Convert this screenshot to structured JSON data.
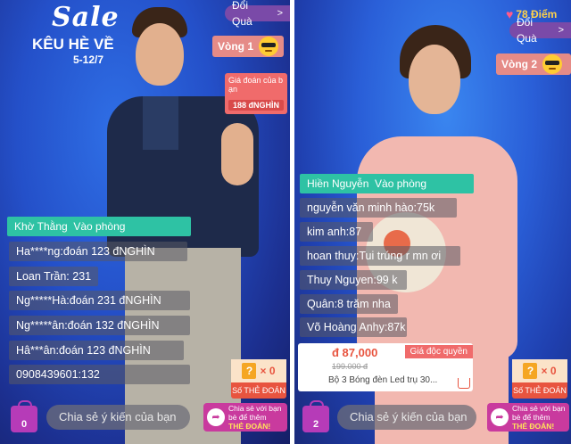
{
  "left": {
    "promo": {
      "title": "Sale",
      "subtitle": "KÊU HÈ VỀ",
      "date": "5-12/7"
    },
    "gift_button": "Đổi Quà",
    "round_label": "Vòng 1",
    "guess_card": {
      "label": "Giá đoán của b ạn",
      "value": "188 đNGHÌN"
    },
    "join_message": {
      "user": "Khờ Thằng",
      "action": "Vào phòng"
    },
    "chat": [
      "Ha****ng:đoán 123 đNGHÌN",
      "Loan Trần: 231",
      "Ng*****Hà:đoán 231 đNGHÌN",
      "Ng*****ân:đoán 132 đNGHÌN",
      "Hâ***ân:đoán 123 đNGHÌN",
      "0908439601:132"
    ],
    "cart_count": "0",
    "comment_placeholder": "Chia sẻ ý kiến của bạn",
    "share": {
      "line1": "Chia sẻ với bạn",
      "line2": "bè để thêm",
      "line3": "THẺ ĐOÁN!"
    },
    "card_box": {
      "count": "× 0",
      "label": "Số THẺ ĐOÁN"
    }
  },
  "right": {
    "score": "78 Điểm",
    "gift_button": "Đổi Quà",
    "round_label": "Vòng 2",
    "join_message": {
      "user": "Hiền Nguyễn",
      "action": "Vào phòng"
    },
    "chat": [
      "nguyễn văn minh hào:75k",
      "kim anh:87",
      "hoan thuy:Tui trúng r mn ơi",
      "Thuy Nguyen:99 k",
      "Quân:8 trăm nha",
      "Võ Hoàng Anhy:87k"
    ],
    "product": {
      "price": "đ 87,000",
      "tag": "Giá độc quyền",
      "old_price": "199.000 đ",
      "name": "Bộ 3 Bóng đèn Led trụ 30..."
    },
    "cart_count": "2",
    "comment_placeholder": "Chia sẻ ý kiến của bạn",
    "share": {
      "line1": "Chia sẻ với bạn",
      "line2": "bè để thêm",
      "line3": "THẺ ĐOÁN!"
    },
    "card_box": {
      "count": "× 0",
      "label": "Số THẺ ĐOÁN"
    }
  },
  "colors": {
    "accent_teal": "#2ec2a4",
    "accent_pink": "#c93a9e",
    "round_badge": "#e58b87"
  },
  "icons": [
    "sunglasses-emoji-icon",
    "shopping-bag-icon",
    "share-arrow-icon",
    "question-card-icon",
    "heart-icon",
    "cart-icon",
    "chevron-right-icon"
  ]
}
